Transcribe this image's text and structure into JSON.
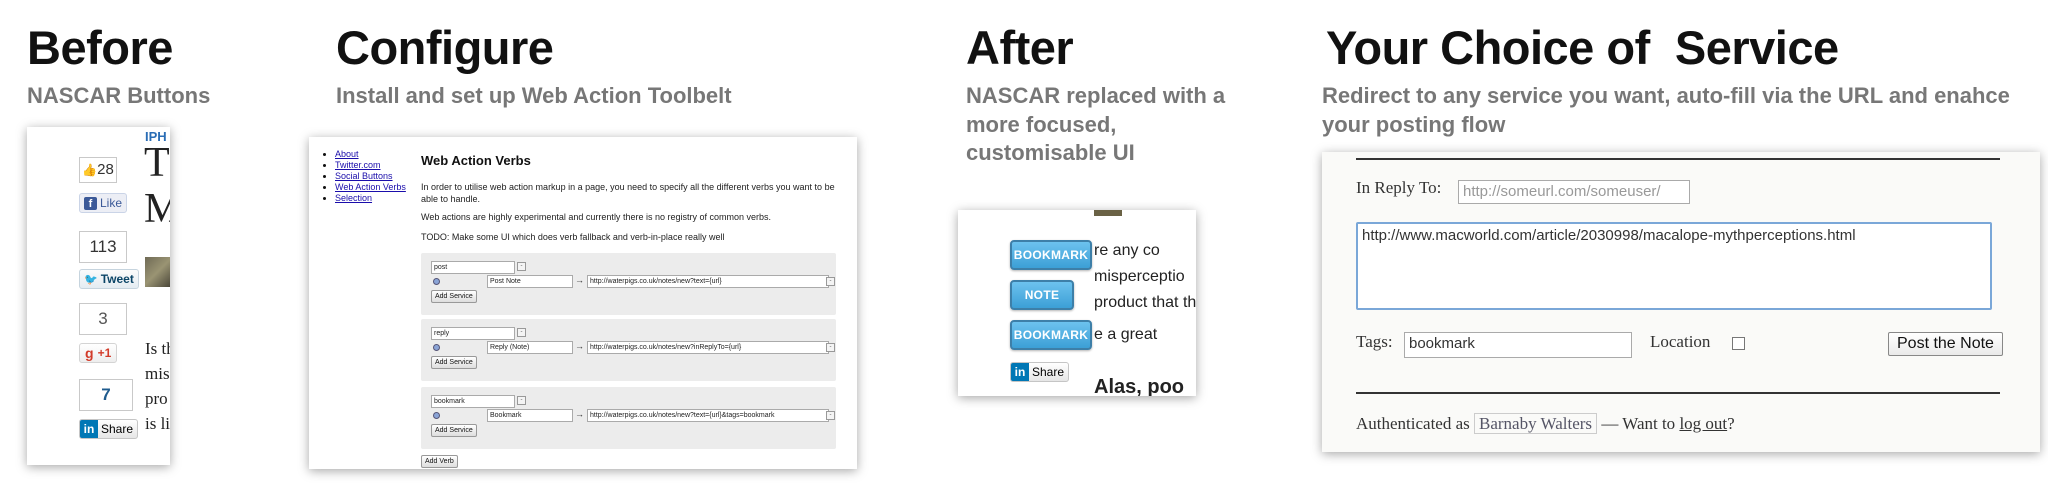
{
  "before": {
    "title": "Before",
    "subtitle": "NASCAR Buttons",
    "facebook": {
      "count": "28",
      "label": "Like"
    },
    "twitter": {
      "count": "113",
      "label": "Tweet"
    },
    "gplus": {
      "count": "3",
      "label": "+1",
      "logo": "g"
    },
    "linkedin": {
      "count": "7",
      "label": "Share",
      "logo": "in"
    },
    "article": {
      "tag": "IPH",
      "line1": "T",
      "line2": "M",
      "p1": "Is th",
      "p2": "mis",
      "p3": "pro",
      "p4": "is li"
    }
  },
  "configure": {
    "title": "Configure",
    "subtitle": "Install and set up Web Action Toolbelt",
    "nav": [
      "About",
      "Twitter.com",
      "Social Buttons",
      "Web Action Verbs",
      "Selection"
    ],
    "heading": "Web Action Verbs",
    "para1": "In order to utilise web action markup in a page, you need to specify all the different verbs you want to be able to handle.",
    "para2": "Web actions are highly experimental and currently there is no registry of common verbs.",
    "para3": "TODO: Make some UI which does verb fallback and verb-in-place really well",
    "verbs": [
      {
        "verb": "post",
        "name": "Post Note",
        "url": "http://waterpigs.co.uk/notes/new?text={url}"
      },
      {
        "verb": "reply",
        "name": "Reply (Note)",
        "url": "http://waterpigs.co.uk/notes/new?inReplyTo={url}"
      },
      {
        "verb": "bookmark",
        "name": "Bookmark",
        "url": "http://waterpigs.co.uk/notes/new?text={url}&tags=bookmark"
      }
    ],
    "add_service": "Add Service",
    "add_verb": "Add Verb",
    "arrow": "→",
    "remove": "-"
  },
  "after": {
    "title": "After",
    "subtitle": "NASCAR replaced with a more focused, customisable UI",
    "buttons": [
      "BOOKMARK",
      "NOTE",
      "BOOKMARK"
    ],
    "linkedin": {
      "logo": "in",
      "label": "Share"
    },
    "text": {
      "l1": "re any co",
      "l2": "misperceptio",
      "l3": "product that th",
      "l4": "e a great",
      "l5": "Alas, poo"
    }
  },
  "service": {
    "title": "Your Choice of  Service",
    "subtitle": "Redirect to any service you want, auto-fill via the URL and enahce your posting flow",
    "in_reply_label": "In Reply To:",
    "in_reply_placeholder": "http://someurl.com/someuser/",
    "content_value": "http://www.macworld.com/article/2030998/macalope-mythperceptions.html",
    "tags_label": "Tags:",
    "tags_value": "bookmark",
    "location_label": "Location",
    "post_button": "Post the Note",
    "auth_prefix": "Authenticated as",
    "auth_user": "Barnaby Walters",
    "auth_mid": "— Want to",
    "logout": "log out",
    "auth_suffix": "?"
  }
}
